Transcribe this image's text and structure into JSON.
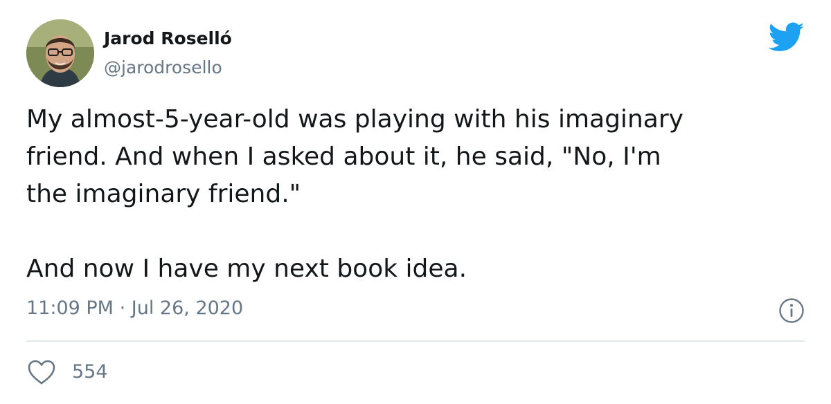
{
  "author": {
    "name": "Jarod Roselló",
    "handle": "@jarodrosello"
  },
  "tweet": {
    "lines": [
      "My almost-5-year-old was playing with his imaginary",
      "friend. And when I asked about it, he said, \"No, I'm",
      "the imaginary friend.\"",
      "And now I have my next book idea."
    ],
    "time": "11:09 PM",
    "separator": "·",
    "date": "Jul 26, 2020"
  },
  "stats": {
    "likes": "554"
  },
  "icons": {
    "brand": "twitter-bird-icon",
    "info": "info-icon",
    "like": "heart-outline-icon"
  },
  "colors": {
    "twitter_blue": "#1da1f2",
    "text_primary": "#14171a",
    "text_secondary": "#657786",
    "divider": "#e1e8ed"
  }
}
